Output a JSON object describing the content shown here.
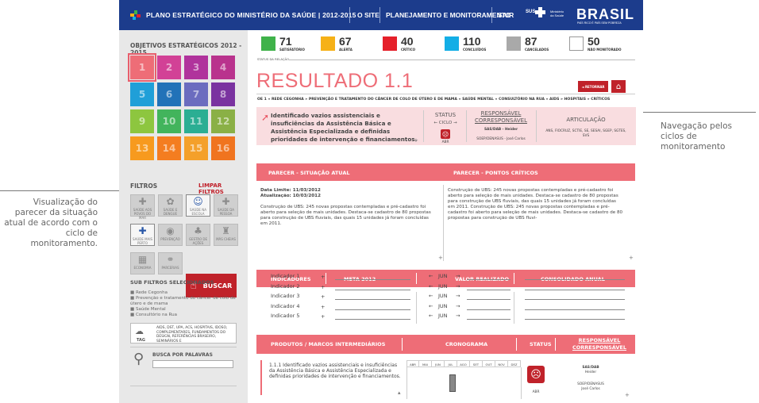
{
  "annotations": {
    "left": "Visualização do parecer da situação atual de acordo com o ciclo de monitoramento.",
    "right": "Navegação pelos ciclos de monitoramento"
  },
  "header": {
    "title": "PLANO ESTRATÉGICO DO MINISTÉRIO DA SAÚDE | 2012-2015",
    "nav": [
      "O SITE",
      "PLANEJAMENTO E MONITORAMENTO",
      "SAIR"
    ],
    "sus": "SUS",
    "ministerio": "Ministério da Saúde",
    "brasil": "BRASIL",
    "brasil_sub": "PAÍS RICO É PAÍS SEM POBREZA"
  },
  "sidebar": {
    "objetivos_title": "OBJETIVOS ESTRATÉGICOS 2012 - 2015",
    "squares": [
      {
        "n": "1",
        "color": "#ee6d77"
      },
      {
        "n": "2",
        "color": "#d24196"
      },
      {
        "n": "3",
        "color": "#b0339c"
      },
      {
        "n": "4",
        "color": "#b9338d"
      },
      {
        "n": "5",
        "color": "#209fd8"
      },
      {
        "n": "6",
        "color": "#2272b8"
      },
      {
        "n": "7",
        "color": "#6b6cbf"
      },
      {
        "n": "8",
        "color": "#7a33a0"
      },
      {
        "n": "9",
        "color": "#8dc63f"
      },
      {
        "n": "10",
        "color": "#42b45c"
      },
      {
        "n": "11",
        "color": "#2bae93"
      },
      {
        "n": "12",
        "color": "#8ab046"
      },
      {
        "n": "13",
        "color": "#f79a1e"
      },
      {
        "n": "14",
        "color": "#f47d20"
      },
      {
        "n": "15",
        "color": "#f4a02a"
      },
      {
        "n": "16",
        "color": "#f0741f"
      }
    ],
    "filtros": "FILTROS",
    "limpar": "LIMPAR FILTROS",
    "filter_buttons": [
      {
        "label": "SAÚDE AOS POVOS DO MAR",
        "icon": "✚"
      },
      {
        "label": "SAÚDE E DENGUE",
        "icon": "✿"
      },
      {
        "label": "SAÚDE NA ESCOLA",
        "icon": "☺"
      },
      {
        "label": "SAÚDE DA PESSOA",
        "icon": "✚"
      },
      {
        "label": "SAÚDE MAIS PERTO",
        "icon": "✚"
      },
      {
        "label": "PREVENÇÃO",
        "icon": "◉"
      },
      {
        "label": "GESTÃO DE AÇÕES",
        "icon": "♣"
      },
      {
        "label": "MÁS CHEIAS",
        "icon": "♜"
      },
      {
        "label": "ECONOMIA",
        "icon": "▦"
      },
      {
        "label": "PARCERIAS",
        "icon": "⚭"
      }
    ],
    "buscar": "BUSCAR",
    "sub_title": "SUB FILTROS SELECIONADOS",
    "sub_items": [
      "Rede Cegonha",
      "Prevenção e tratamento do câncer de colo de útero e de mama",
      "Saúde Mental",
      "Consultório na Rua"
    ],
    "tag_label": "TAG",
    "tag_text": "AIDS, DST, UPA, ACS, HOSPITAIS, IDOSO, COMPLEMENTARES, FUNDAMENTOS DO DESIGN, REFERÊNCIAS BRASEIRO, SEMINÁRIOS E",
    "busca_palavras": "BUSCA POR PALAVRAS"
  },
  "stats": [
    {
      "n": "71",
      "l": "SATISFATÓRIO",
      "color": "#3fb24a"
    },
    {
      "n": "67",
      "l": "ALERTA",
      "color": "#f6b117"
    },
    {
      "n": "40",
      "l": "CRÍTICO",
      "color": "#e5202a"
    },
    {
      "n": "110",
      "l": "CONCLUÍDOS",
      "color": "#13aee6"
    },
    {
      "n": "87",
      "l": "CANCELADOS",
      "color": "#a9a9a9"
    },
    {
      "n": "50",
      "l": "NÃO MONITORADO",
      "color": "#ffffff"
    }
  ],
  "status_relacao": "STATUS DA RELAÇÃO",
  "resultado": {
    "title": "RESULTADO 1.1",
    "retornar": "◄ RETORNAR",
    "sub": "OE 1 » REDE CEGONHA » PREVENÇÃO E TRATAMENTO DO CÂNCER DE COLO DE ÚTERO E DE MAMA » SAÚDE MENTAL » CONSULTÓRIO NA RUA » AIDS » HOSPITAIS » CRÍTICOS",
    "info": "Identificado vazios assistenciais e insuficiências da Assistência Básica e Assistência Especializada e definidas prioridades de intervenção e financiamentos.",
    "status_label": "STATUS",
    "ciclo": "CICLO",
    "abr": "ABR",
    "responsavel": "RESPONSÁVEL CORRESPONSÁVEL",
    "resp1": "SAS/DAB - Heider",
    "resp2": "SOEP/DENASUS - José Carlos",
    "articulacao": "ARTICULAÇÃO",
    "articulacao_val": "ANS, FIOCRUZ, SCTIE, SE, SESAI, SGEP, SGTES, SVS"
  },
  "parecer": {
    "h1": "PARECER - SITUAÇÃO ATUAL",
    "h2": "PARECER - PONTOS CRÍTICOS",
    "data_limite": "Data Limite: 11/03/2012",
    "atualizacao": "Atualização: 10/03/2012",
    "body_left": "Construção de UBS: 245 novas propostas contempladas e pré-cadastro foi aberto para seleção de mais unidades. Destaca-se cadastro de 80 propostas para construção de UBS fluviais, das quais 15 unidades já foram concluídas em 2011.",
    "body_right": "Construção de UBS: 245 novas propostas contempladas e pré-cadastro foi aberto para seleção de mais unidades. Destaca-se cadastro de 80 propostas para construção de UBS fluviais, das quais 15 unidades já foram concluídas em 2011. Construção de UBS: 245 novas propostas contempladas e pré-cadastro foi aberto para seleção de mais unidades. Destaca-se cadastro de 80 propostas para construção de UBS fluvi-"
  },
  "indicadores": {
    "h1": "INDICADORES",
    "h2": "META 2012",
    "h3": "VALOR REALIZADO",
    "h4": "CONSOLIDADO ANUAL",
    "rows": [
      "Indicador 1",
      "Indicador 2",
      "Indicador 3",
      "Indicador 4",
      "Indicador 5"
    ],
    "month": "JUN"
  },
  "produtos": {
    "h1": "PRODUTOS / MARCOS INTERMEDIÁRIOS",
    "h2": "CRONOGRAMA",
    "h3": "STATUS",
    "h4": "RESPONSÁVEL CORRESPONSÁVEL",
    "item": "1.1.1 Identificado vazios assistenciais e insuficiências da Assistência Básica e Assistência Especializada e definidas prioridades de intervenção e financiamentos.",
    "months": [
      "ABR",
      "MAI",
      "JUN",
      "JUL",
      "AGO",
      "SET",
      "OUT",
      "NOV",
      "DEZ"
    ],
    "abr": "ABR",
    "resp1": "SAS/DAB",
    "resp1b": "Heider",
    "resp2": "SOEP/DENASUS",
    "resp2b": "José Carlos"
  }
}
